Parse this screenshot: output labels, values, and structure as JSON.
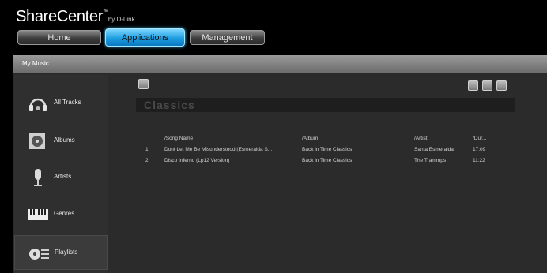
{
  "header": {
    "brand": "ShareCenter",
    "brand_tm": "™",
    "brand_by": "by D-Link",
    "tabs": [
      {
        "label": "Home",
        "active": false
      },
      {
        "label": "Applications",
        "active": true
      },
      {
        "label": "Management",
        "active": false
      }
    ]
  },
  "panel": {
    "title": "My Music"
  },
  "sidebar": {
    "items": [
      {
        "label": "All Tracks",
        "icon": "headphones-icon",
        "selected": false
      },
      {
        "label": "Albums",
        "icon": "album-icon",
        "selected": false
      },
      {
        "label": "Artists",
        "icon": "microphone-icon",
        "selected": false
      },
      {
        "label": "Genres",
        "icon": "keyboard-icon",
        "selected": false
      },
      {
        "label": "Playlists",
        "icon": "playlist-icon",
        "selected": true
      }
    ]
  },
  "playlist": {
    "title": "Classics",
    "columns": {
      "song": "/Song Name",
      "album": "/Album",
      "artist": "/Artist",
      "duration": "/Dur..."
    },
    "rows": [
      {
        "num": "1",
        "song": "Dont Let Me Be Misunderstood (Esmeralda S...",
        "album": "Back in Time Classics",
        "artist": "Santa Esmeralda",
        "duration": "17:09"
      },
      {
        "num": "2",
        "song": "Disco Inferno (Lp12 Version)",
        "album": "Back in Time Classics",
        "artist": "The Trammps",
        "duration": "11:22"
      }
    ]
  },
  "toolbar": {
    "left_icon": "edit-icon",
    "right_icons": [
      "save-icon",
      "pencil-icon",
      "add-icon"
    ]
  },
  "colors": {
    "accent": "#1d9ee0",
    "panel_bg": "#2b2b2b",
    "header_bar": "#8a8a8a"
  }
}
